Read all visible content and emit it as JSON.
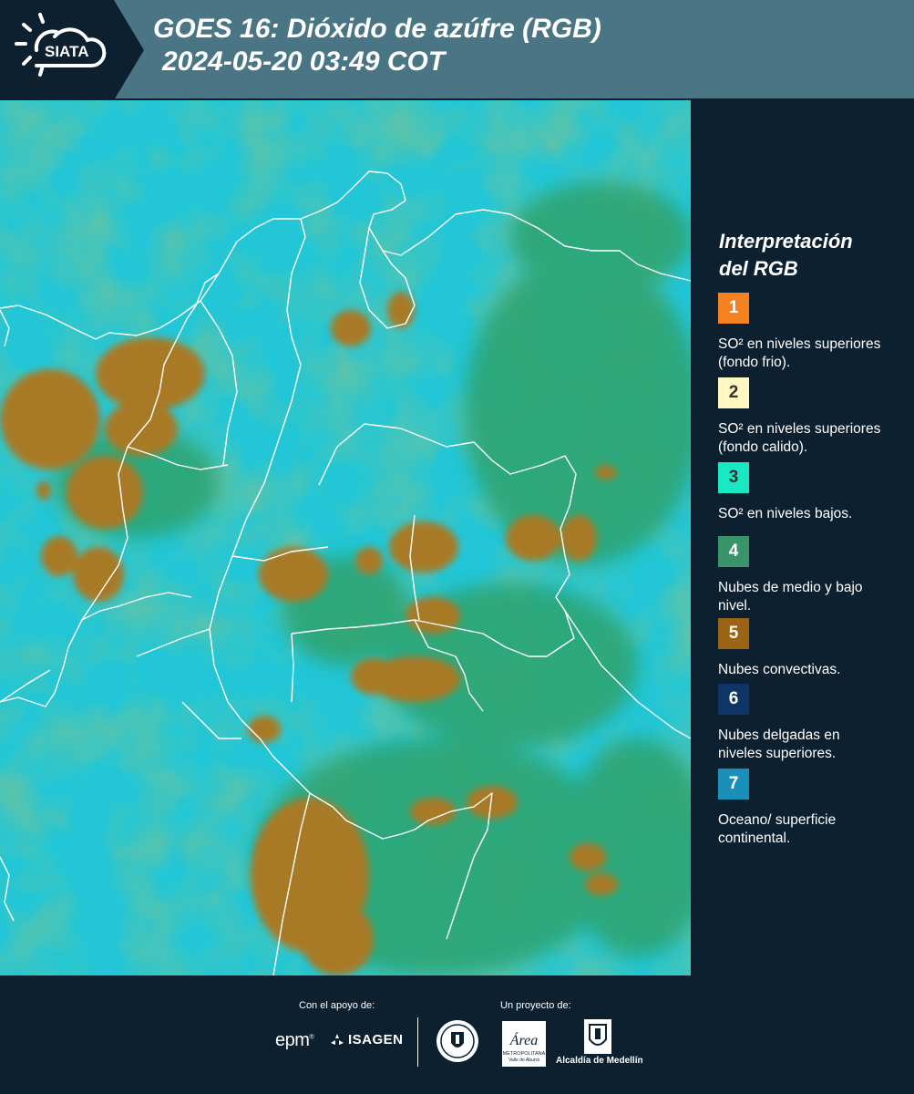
{
  "header": {
    "logo_text": "SIATA",
    "title_line1": "GOES 16: Dióxido de azúfre (RGB)",
    "title_line2": "2024-05-20 03:49 COT"
  },
  "legend": {
    "title_line1": "Interpretación",
    "title_line2": "del RGB",
    "items": [
      {
        "num": "1",
        "color": "#f58220",
        "text_color": "#ffffff",
        "label": "SO² en niveles superiores (fondo frio)."
      },
      {
        "num": "2",
        "color": "#fff7c2",
        "text_color": "#333333",
        "label": "SO² en niveles superiores (fondo calido)."
      },
      {
        "num": "3",
        "color": "#19e8c4",
        "text_color": "#333333",
        "label": "SO² en niveles bajos."
      },
      {
        "num": "4",
        "color": "#3a946a",
        "text_color": "#ffffff",
        "label": "Nubes de medio y bajo nivel."
      },
      {
        "num": "5",
        "color": "#9a6414",
        "text_color": "#ffffff",
        "label": "Nubes convectivas."
      },
      {
        "num": "6",
        "color": "#0f3566",
        "text_color": "#ffffff",
        "label": "Nubes delgadas en niveles superiores."
      },
      {
        "num": "7",
        "color": "#1a8fb8",
        "text_color": "#ffffff",
        "label": "Oceano/ superficie continental."
      }
    ]
  },
  "footer": {
    "support_caption": "Con el apoyo de:",
    "project_caption": "Un proyecto de:",
    "sponsor1": "epm",
    "sponsor2": "ISAGEN",
    "partner_area": "Área",
    "partner_area_sub1": "METROPOLITANA",
    "partner_area_sub2": "Valle de Aburrá",
    "partner_alcaldia": "Alcaldía de Medellín"
  },
  "map": {
    "colors": {
      "background": "#22c6d6",
      "green": "#2fa36e",
      "dark_green": "#1f7a4a",
      "convective": "#a87a28",
      "convective_edge": "#6a5a20",
      "border_lines": "#ffffff"
    }
  }
}
